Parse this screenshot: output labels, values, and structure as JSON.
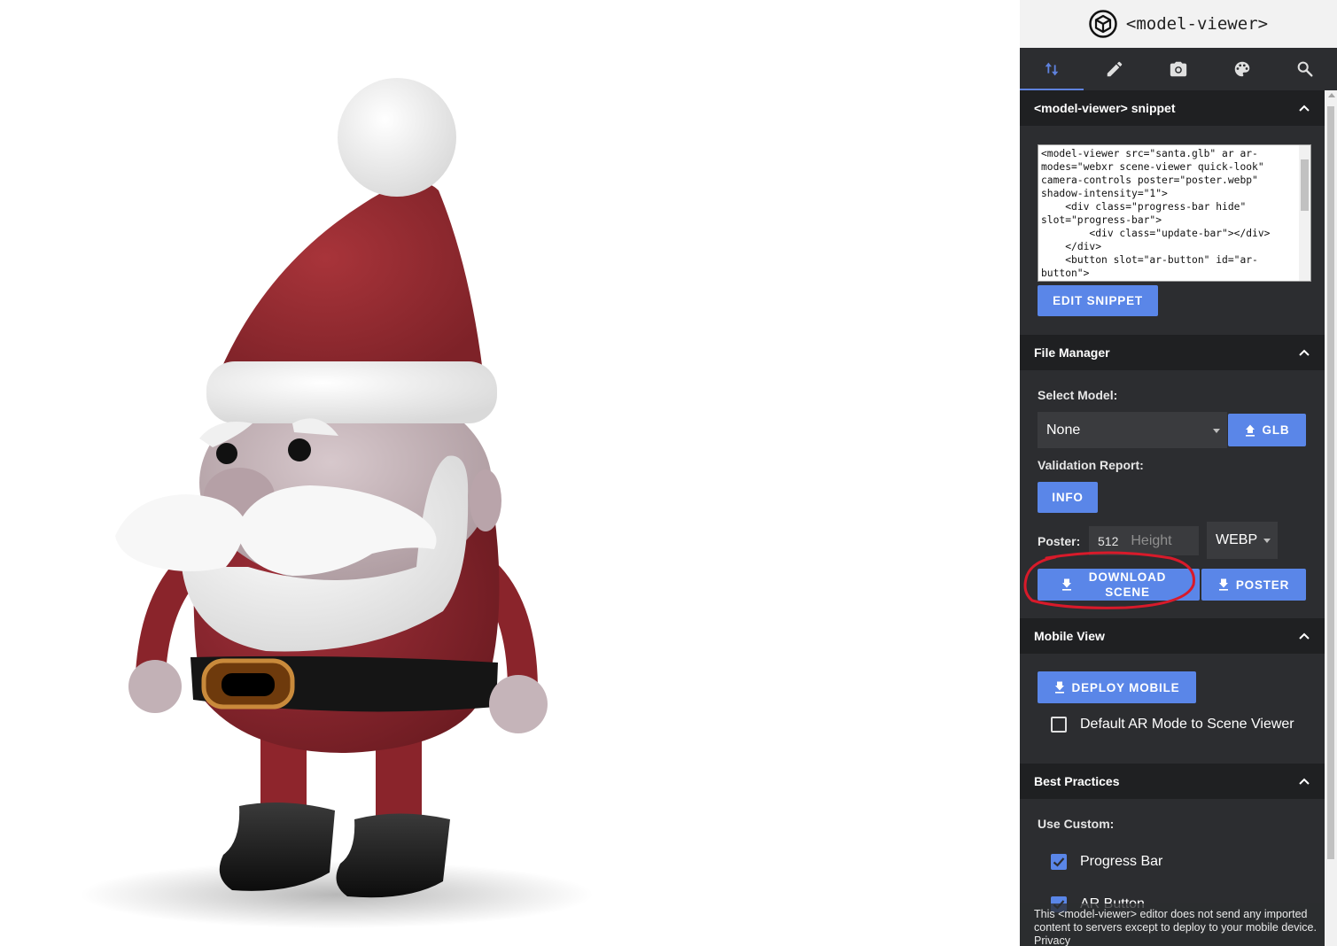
{
  "brand": {
    "title": "<model-viewer>",
    "icon": "model-viewer-logo-icon"
  },
  "tabs": [
    {
      "icon": "sort-arrows-icon",
      "active": true
    },
    {
      "icon": "pencil-icon",
      "active": false
    },
    {
      "icon": "camera-icon",
      "active": false
    },
    {
      "icon": "palette-icon",
      "active": false
    },
    {
      "icon": "search-icon",
      "active": false
    }
  ],
  "snippet": {
    "title": "<model-viewer> snippet",
    "code": "<model-viewer src=\"santa.glb\" ar ar-modes=\"webxr scene-viewer quick-look\" camera-controls poster=\"poster.webp\" shadow-intensity=\"1\">\n    <div class=\"progress-bar hide\" slot=\"progress-bar\">\n        <div class=\"update-bar\"></div>\n    </div>\n    <button slot=\"ar-button\" id=\"ar-button\">",
    "edit_label": "EDIT SNIPPET"
  },
  "file_manager": {
    "title": "File Manager",
    "select_model_label": "Select Model:",
    "model_value": "None",
    "glb_label": "GLB",
    "validation_label": "Validation Report:",
    "info_label": "INFO",
    "poster_label": "Poster:",
    "poster_width": "512",
    "poster_height_placeholder": "Height",
    "poster_format": "WEBP",
    "download_scene_label": "DOWNLOAD SCENE",
    "poster_button_label": "POSTER"
  },
  "mobile_view": {
    "title": "Mobile View",
    "deploy_label": "DEPLOY MOBILE",
    "default_ar_label": "Default AR Mode to Scene Viewer",
    "default_ar_checked": false
  },
  "best_practices": {
    "title": "Best Practices",
    "use_custom_label": "Use Custom:",
    "progress_bar_label": "Progress Bar",
    "progress_bar_checked": true,
    "ar_button_label": "AR Button",
    "ar_button_checked": true
  },
  "footer": {
    "text": "This <model-viewer> editor does not send any imported content to servers except to deploy to your mobile device. Privacy"
  },
  "colors": {
    "accent": "#5a86e8",
    "panel_bg": "#2c2d30",
    "section_bg": "#1f2022",
    "annotation_red": "#d81a2a"
  }
}
